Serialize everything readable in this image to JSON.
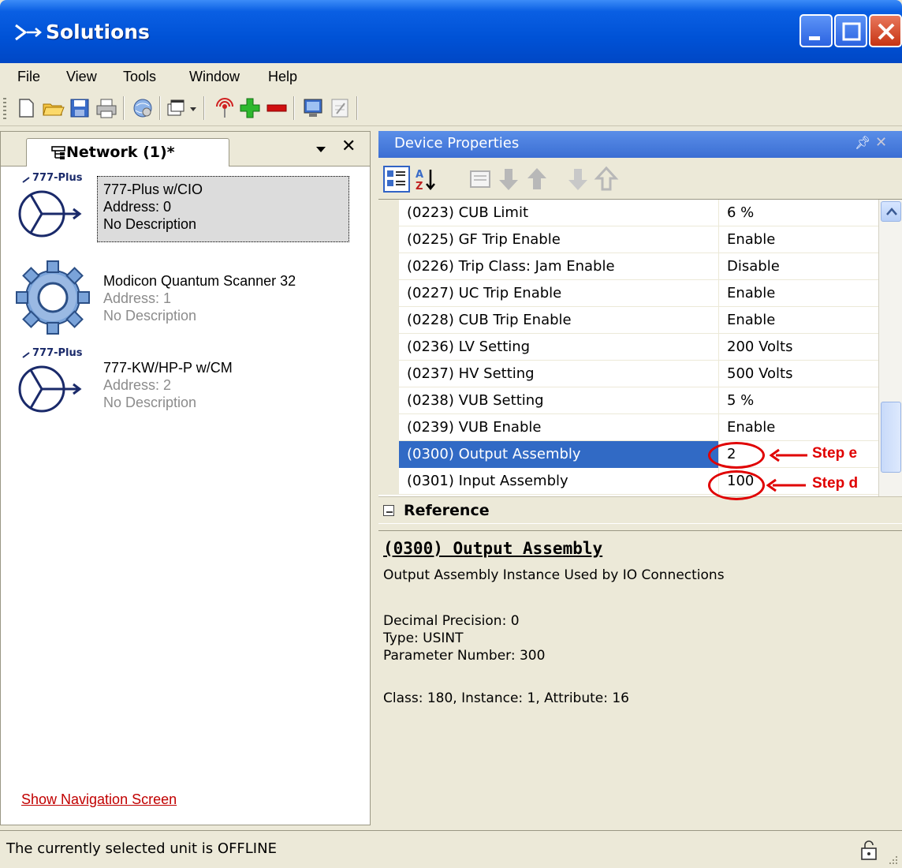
{
  "window": {
    "title": "Solutions"
  },
  "menu": [
    "File",
    "View",
    "Tools",
    "Window",
    "Help"
  ],
  "left_pane": {
    "tab_label": "Network (1)*",
    "devices": [
      {
        "badge": "777-Plus",
        "name": "777-Plus w/CIO",
        "address": "Address: 0",
        "description": "No Description",
        "selected": true,
        "icon": "motor-relay-icon"
      },
      {
        "badge": "",
        "name": "Modicon Quantum Scanner 32",
        "address": "Address: 1",
        "description": "No Description",
        "selected": false,
        "icon": "gear-icon"
      },
      {
        "badge": "777-Plus",
        "name": "777-KW/HP-P w/CM",
        "address": "Address: 2",
        "description": "No Description",
        "selected": false,
        "icon": "motor-relay-icon"
      }
    ],
    "nav_link": "Show Navigation Screen"
  },
  "device_properties": {
    "title": "Device Properties",
    "rows": [
      {
        "name": "(0223) CUB Limit",
        "value": "6 %"
      },
      {
        "name": "(0225) GF Trip Enable",
        "value": "Enable"
      },
      {
        "name": "(0226) Trip Class: Jam Enable",
        "value": "Disable"
      },
      {
        "name": "(0227) UC Trip Enable",
        "value": "Enable"
      },
      {
        "name": "(0228) CUB Trip Enable",
        "value": "Enable"
      },
      {
        "name": "(0236) LV Setting",
        "value": "200 Volts"
      },
      {
        "name": "(0237) HV Setting",
        "value": "500 Volts"
      },
      {
        "name": "(0238) VUB Setting",
        "value": "5 %"
      },
      {
        "name": "(0239) VUB Enable",
        "value": "Enable"
      },
      {
        "name": "(0300) Output Assembly",
        "value": "2",
        "selected": true
      },
      {
        "name": "(0301) Input Assembly",
        "value": "100"
      }
    ],
    "category": "Reference",
    "description": {
      "title": "(0300) Output Assembly",
      "summary": "Output Assembly Instance Used by IO Connections",
      "precision": "Decimal Precision: 0",
      "type": "Type: USINT",
      "param_number": "Parameter Number: 300",
      "class_info": "Class: 180, Instance: 1, Attribute: 16"
    }
  },
  "annotations": {
    "step_e": "Step e",
    "step_d": "Step d"
  },
  "status": {
    "text": "The currently selected unit is OFFLINE"
  },
  "colors": {
    "title_blue": "#0052d6",
    "selection": "#316ac5",
    "annotation_red": "#e00000",
    "link_red": "#c10000"
  }
}
